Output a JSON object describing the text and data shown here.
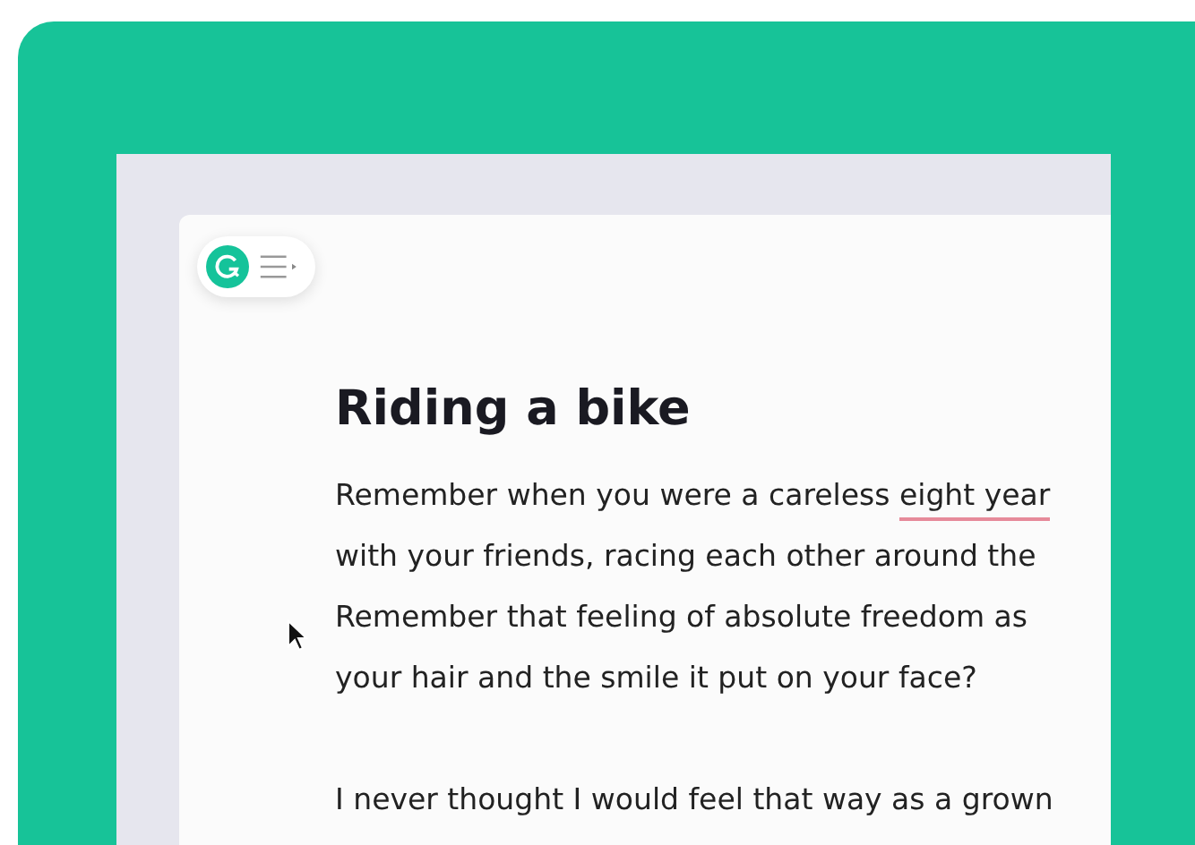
{
  "editor": {
    "title": "Riding a bike",
    "paragraphs": [
      {
        "lines": [
          [
            {
              "text": "Remember when you were a careless ",
              "underlined": false
            },
            {
              "text": "eight year",
              "underlined": true
            }
          ],
          [
            {
              "text": "with your friends, racing each other around the",
              "underlined": false
            }
          ],
          [
            {
              "text": "Remember that feeling of absolute freedom as",
              "underlined": false
            }
          ],
          [
            {
              "text": "your hair and the smile it put on your face?",
              "underlined": false
            }
          ]
        ]
      },
      {
        "lines": [
          [
            {
              "text": "I never thought I would feel that way as a grown",
              "underlined": false
            }
          ]
        ]
      }
    ]
  }
}
